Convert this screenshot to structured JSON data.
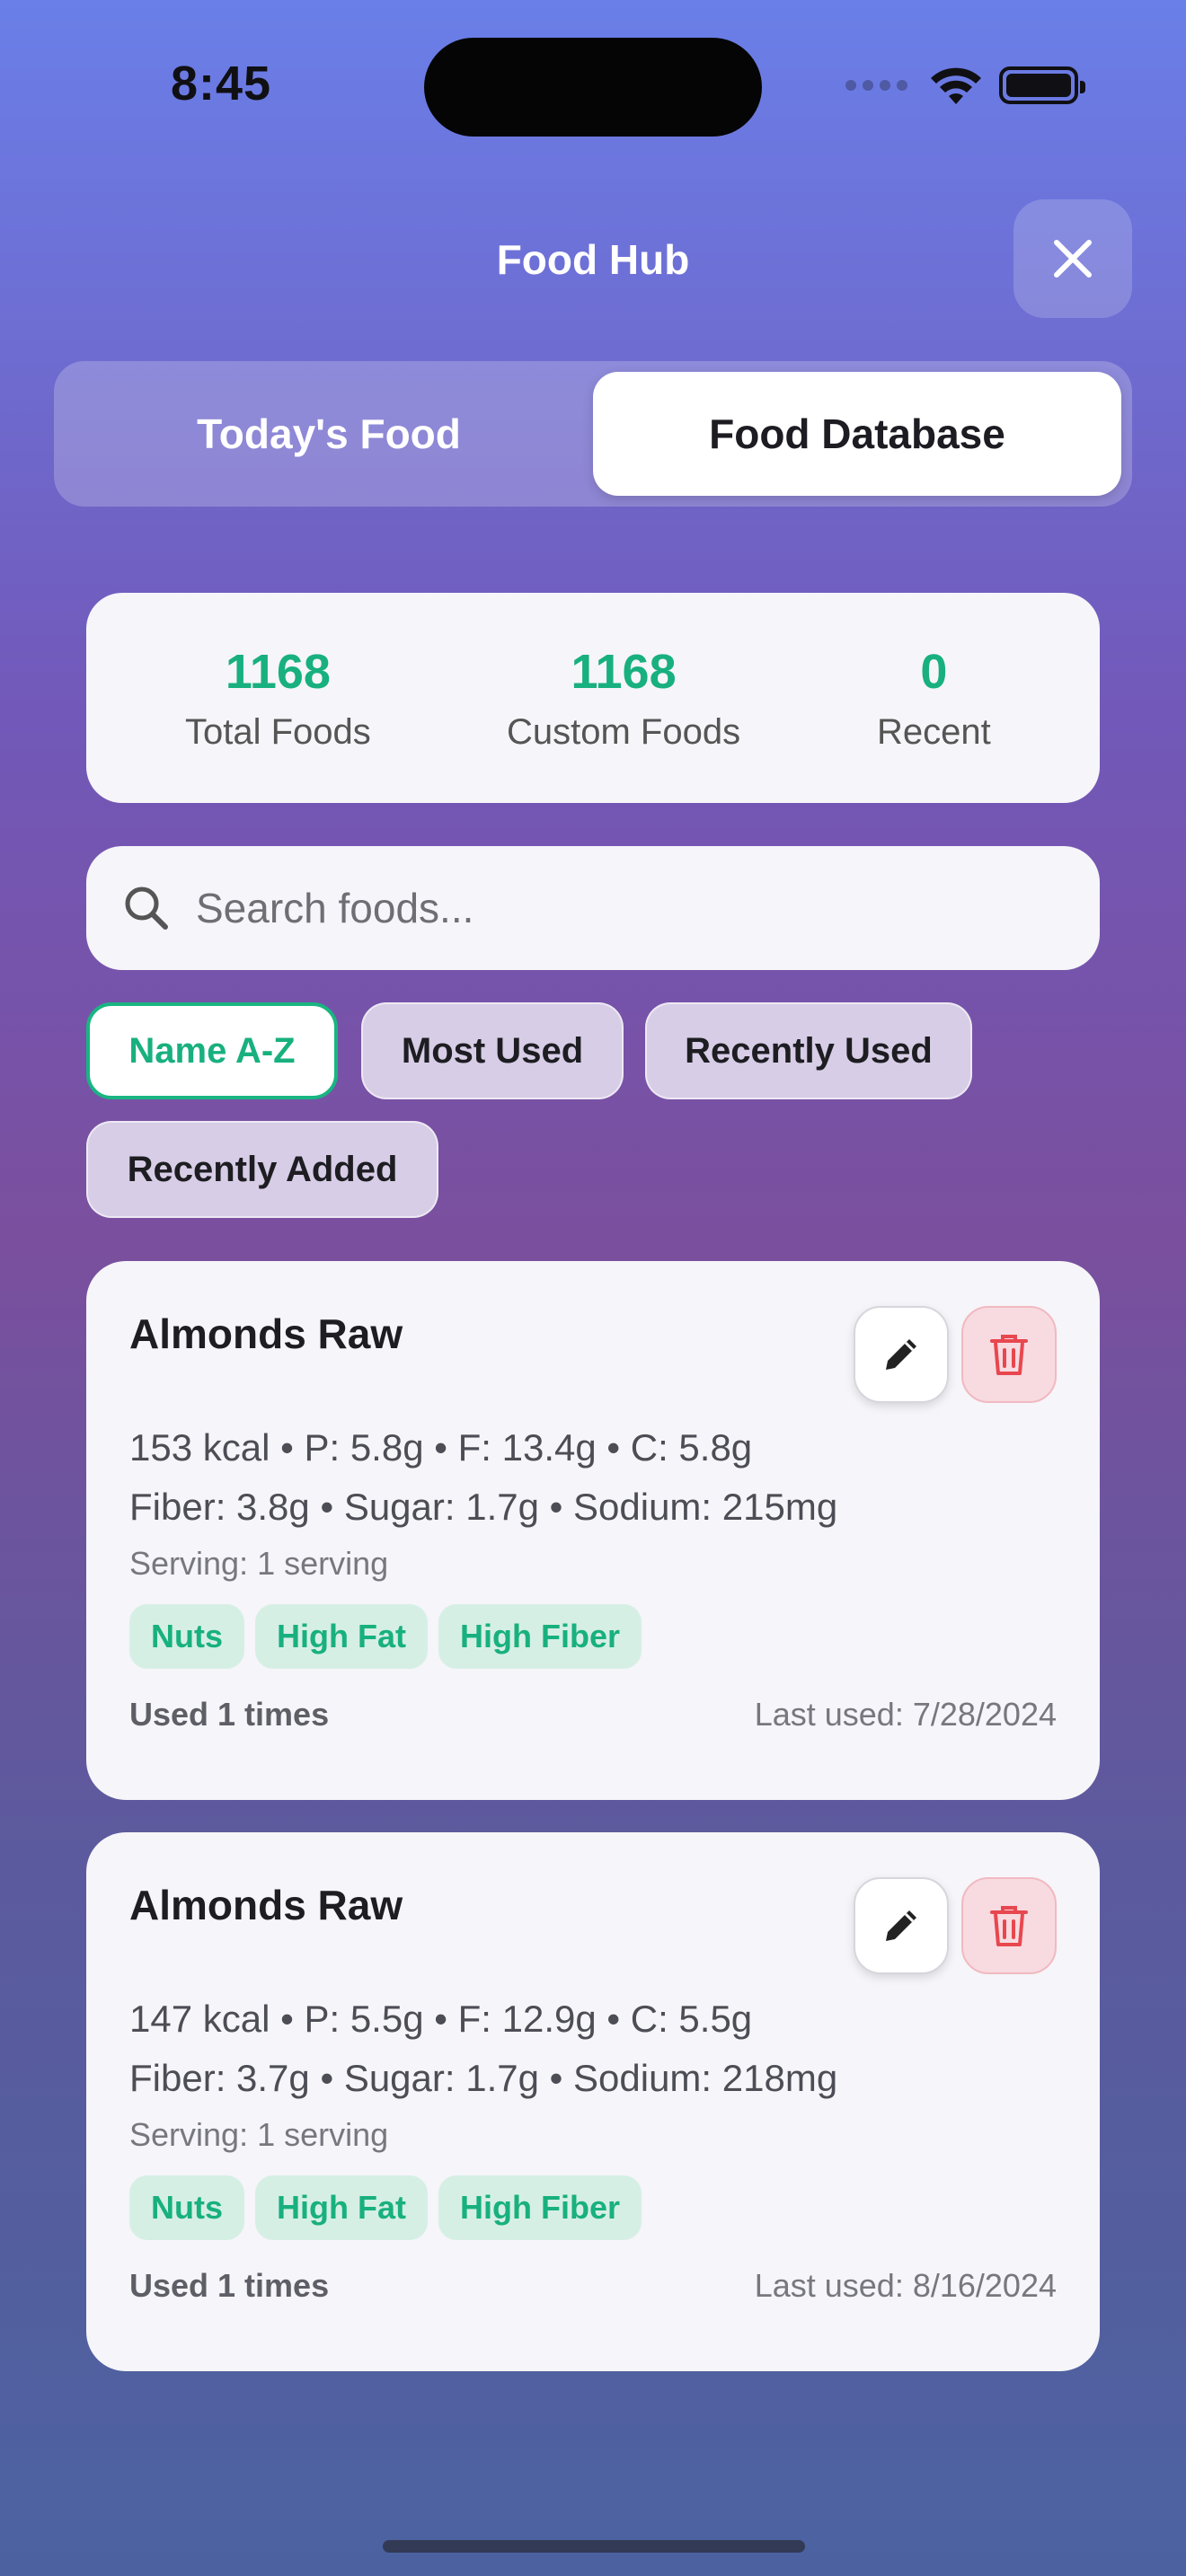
{
  "status": {
    "time": "8:45"
  },
  "header": {
    "title": "Food Hub"
  },
  "tabs": [
    {
      "label": "Today's Food",
      "active": false
    },
    {
      "label": "Food Database",
      "active": true
    }
  ],
  "stats": [
    {
      "value": "1168",
      "label": "Total Foods"
    },
    {
      "value": "1168",
      "label": "Custom Foods"
    },
    {
      "value": "0",
      "label": "Recent"
    }
  ],
  "search": {
    "placeholder": "Search foods..."
  },
  "sort_chips": [
    {
      "label": "Name A-Z",
      "active": true
    },
    {
      "label": "Most Used",
      "active": false
    },
    {
      "label": "Recently Used",
      "active": false
    },
    {
      "label": "Recently Added",
      "active": false
    }
  ],
  "foods": [
    {
      "name": "Almonds Raw",
      "line1": "153 kcal • P: 5.8g • F: 13.4g • C: 5.8g",
      "line2": "Fiber: 3.8g • Sugar: 1.7g • Sodium: 215mg",
      "serving": "Serving: 1 serving",
      "tags": [
        "Nuts",
        "High Fat",
        "High Fiber"
      ],
      "used": "Used 1 times",
      "last_used": "Last used: 7/28/2024"
    },
    {
      "name": "Almonds Raw",
      "line1": "147 kcal • P: 5.5g • F: 12.9g • C: 5.5g",
      "line2": "Fiber: 3.7g • Sugar: 1.7g • Sodium: 218mg",
      "serving": "Serving: 1 serving",
      "tags": [
        "Nuts",
        "High Fat",
        "High Fiber"
      ],
      "used": "Used 1 times",
      "last_used": "Last used: 8/16/2024"
    }
  ],
  "colors": {
    "accent": "#18b07e",
    "danger": "#e8474f"
  },
  "icons": {
    "close": "close-icon",
    "search": "search-icon",
    "edit": "pencil-icon",
    "delete": "trash-icon"
  }
}
